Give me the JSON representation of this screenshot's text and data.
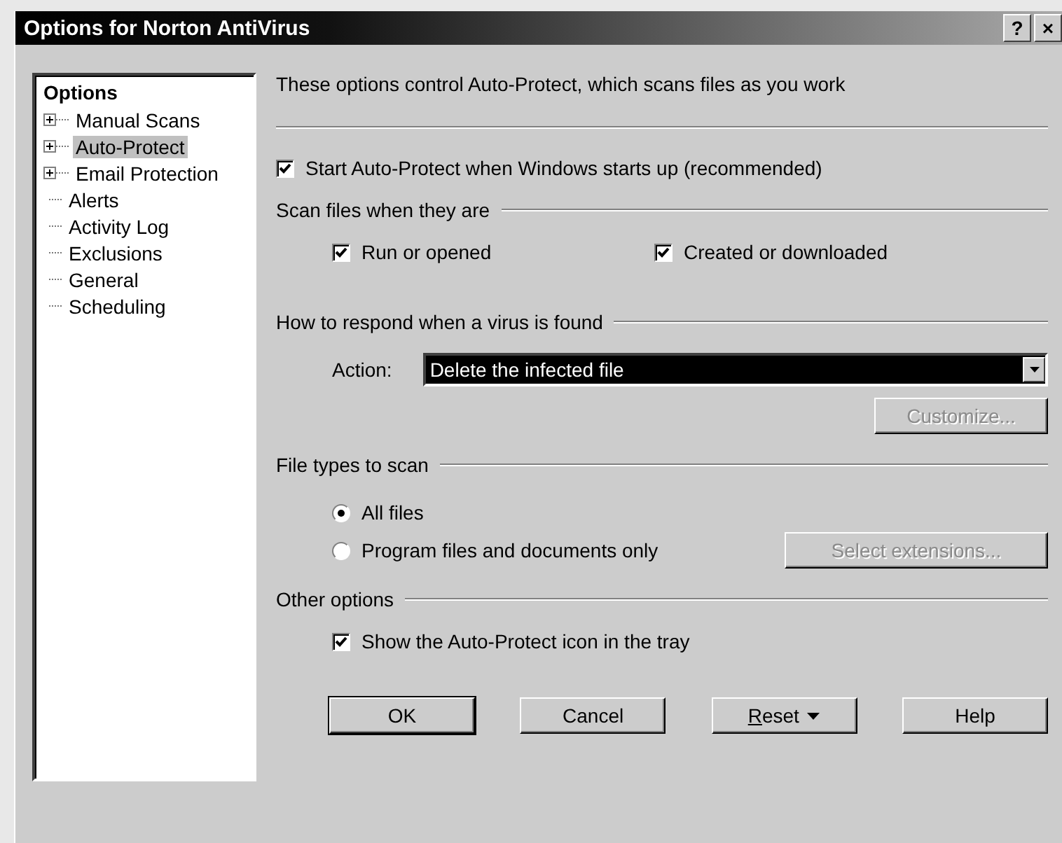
{
  "window": {
    "title": "Options for Norton AntiVirus",
    "help_glyph": "?",
    "close_glyph": "×"
  },
  "tree": {
    "title": "Options",
    "items": [
      {
        "label": "Manual Scans",
        "expandable": true,
        "selected": false
      },
      {
        "label": "Auto-Protect",
        "expandable": true,
        "selected": true
      },
      {
        "label": "Email Protection",
        "expandable": true,
        "selected": false
      },
      {
        "label": "Alerts",
        "expandable": false,
        "selected": false
      },
      {
        "label": "Activity Log",
        "expandable": false,
        "selected": false
      },
      {
        "label": "Exclusions",
        "expandable": false,
        "selected": false
      },
      {
        "label": "General",
        "expandable": false,
        "selected": false
      },
      {
        "label": "Scheduling",
        "expandable": false,
        "selected": false
      }
    ]
  },
  "description": "These options control Auto-Protect, which scans files as you work",
  "start_option": {
    "label": "Start Auto-Protect when Windows starts up (recommended)",
    "checked": true
  },
  "scan_group": {
    "title": "Scan files when they are",
    "options": [
      {
        "label": "Run or opened",
        "checked": true
      },
      {
        "label": "Created or downloaded",
        "checked": true
      }
    ]
  },
  "respond_group": {
    "title": "How to respond when a virus is found",
    "action_label": "Action:",
    "action_value": "Delete the infected file",
    "customize": {
      "label": "Customize...",
      "disabled": true
    }
  },
  "file_types_group": {
    "title": "File types to scan",
    "options": [
      {
        "label": "All files",
        "selected": true
      },
      {
        "label": "Program files and documents only",
        "selected": false
      }
    ],
    "extensions": {
      "label": "Select extensions...",
      "disabled": true
    }
  },
  "other_group": {
    "title": "Other options",
    "options": [
      {
        "label": "Show the Auto-Protect icon in the tray",
        "checked": true
      }
    ]
  },
  "buttons": [
    {
      "label": "OK",
      "kind": "default"
    },
    {
      "label": "Cancel",
      "kind": "plain"
    },
    {
      "label": "Reset",
      "kind": "menu"
    },
    {
      "label": "Help",
      "kind": "plain"
    }
  ]
}
